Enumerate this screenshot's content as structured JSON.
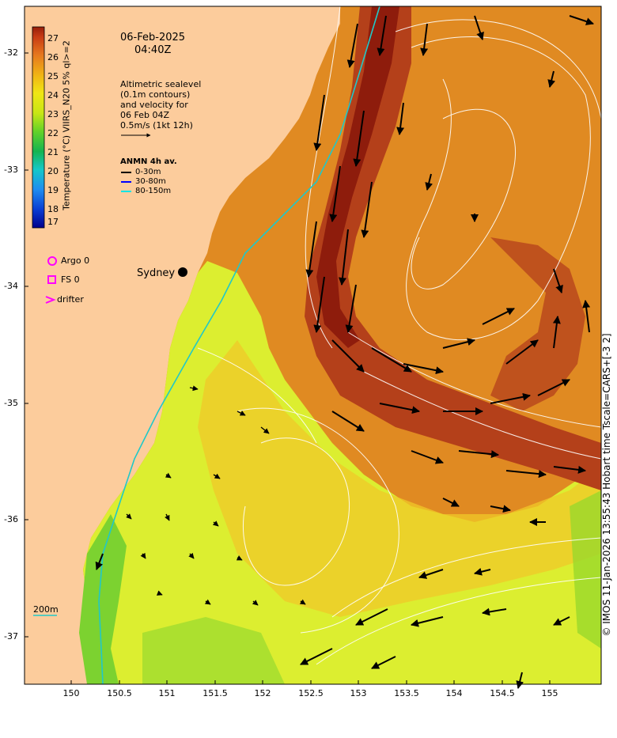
{
  "map": {
    "date": "06-Feb-2025",
    "time": "04:40Z",
    "altimetry_note": [
      "Altimetric sealevel",
      "(0.1m contours)",
      "and velocity for",
      "06 Feb 04Z",
      "0.5m/s (1kt 12h)"
    ],
    "anmn_title": "ANMN 4h av.",
    "anmn_legend": [
      {
        "label": "0-30m",
        "color": "#000000"
      },
      {
        "label": "30-80m",
        "color": "#0000ff"
      },
      {
        "label": "80-150m",
        "color": "#00e5e5"
      }
    ],
    "obs_legend": [
      {
        "label": "Argo 0",
        "symbol": "circle",
        "color": "#ff00ff"
      },
      {
        "label": "FS 0",
        "symbol": "square",
        "color": "#ff00ff"
      },
      {
        "label": "drifter",
        "symbol": "chevron",
        "color": "#ff00ff"
      }
    ],
    "city_label": "Sydney",
    "isobath_label": "200m",
    "credit": "© IMOS 11-Jan-2026 13:55:43 Hobart time Tscale=CARS+[-3 2]",
    "colorbar": {
      "title": "Temperature (°C) VIIRS_N20 5% ql>=2",
      "min": 17,
      "max": 27.5,
      "ticks": [
        "27",
        "26",
        "25",
        "24",
        "23",
        "22",
        "21",
        "20",
        "19",
        "18",
        "17"
      ]
    },
    "lat_ticks": [
      "-32",
      "-33",
      "-34",
      "-35",
      "-36",
      "-37"
    ],
    "lon_ticks": [
      "150",
      "150.5",
      "151",
      "151.5",
      "152",
      "152.5",
      "153",
      "153.5",
      "154",
      "154.5",
      "155"
    ],
    "colors": {
      "land": "#fccc9c",
      "warm_core": "#a82c10",
      "shelf": "#d4f024",
      "coast": "#00d0d0"
    }
  }
}
